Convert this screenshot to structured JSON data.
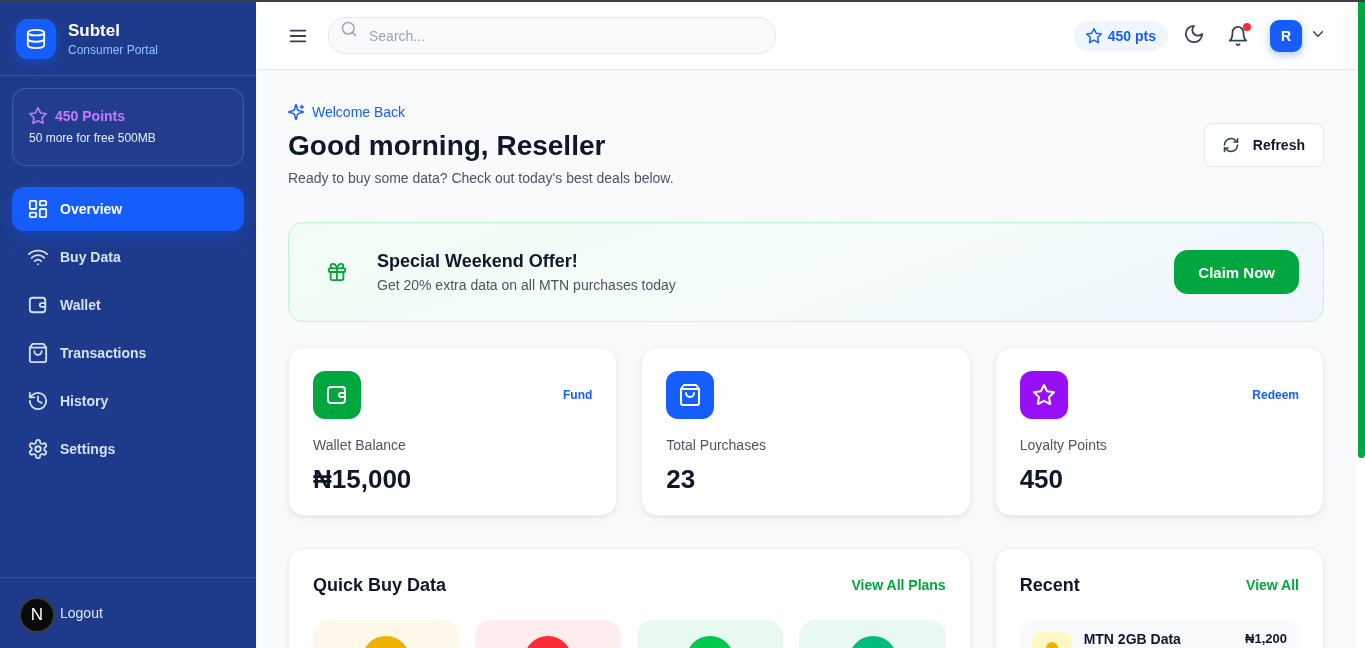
{
  "sidebar": {
    "brand": {
      "name": "Subtel",
      "subtitle": "Consumer Portal"
    },
    "points_card": {
      "title": "450 Points",
      "note": "50 more for free 500MB"
    },
    "nav": [
      {
        "label": "Overview",
        "selected": true
      },
      {
        "label": "Buy Data",
        "selected": false
      },
      {
        "label": "Wallet",
        "selected": false
      },
      {
        "label": "Transactions",
        "selected": false
      },
      {
        "label": "History",
        "selected": false
      },
      {
        "label": "Settings",
        "selected": false
      }
    ],
    "logout": "Logout"
  },
  "dev_badge": "N",
  "topbar": {
    "search": {
      "placeholder": "Search..."
    },
    "points": "450 pts",
    "notifications": {
      "unread": true
    },
    "avatar": "R"
  },
  "header": {
    "eyebrow": "Welcome Back",
    "title": "Good morning, Reseller",
    "subtitle": "Ready to buy some data? Check out today's best deals below.",
    "refresh": "Refresh"
  },
  "offer": {
    "title": "Special Weekend Offer!",
    "text": "Get 20% extra data on all MTN purchases today",
    "button": "Claim Now"
  },
  "stats": [
    {
      "label": "Wallet Balance",
      "value": "₦15,000",
      "action": "Fund",
      "color": "#00a63e"
    },
    {
      "label": "Total Purchases",
      "value": "23",
      "color": "#155dfc"
    },
    {
      "label": "Loyalty Points",
      "value": "450",
      "action": "Redeem",
      "color": "#9810fa"
    }
  ],
  "quick_buy": {
    "title": "Quick Buy Data",
    "link": "View All Plans",
    "plans": [
      {
        "color": "#f0b100"
      },
      {
        "color": "#fb2c36"
      },
      {
        "color": "#00c950"
      },
      {
        "color": "#00bc7d"
      }
    ]
  },
  "recent": {
    "title": "Recent",
    "link": "View All",
    "items": [
      {
        "name": "MTN 2GB Data",
        "amount": "₦1,200"
      }
    ]
  }
}
